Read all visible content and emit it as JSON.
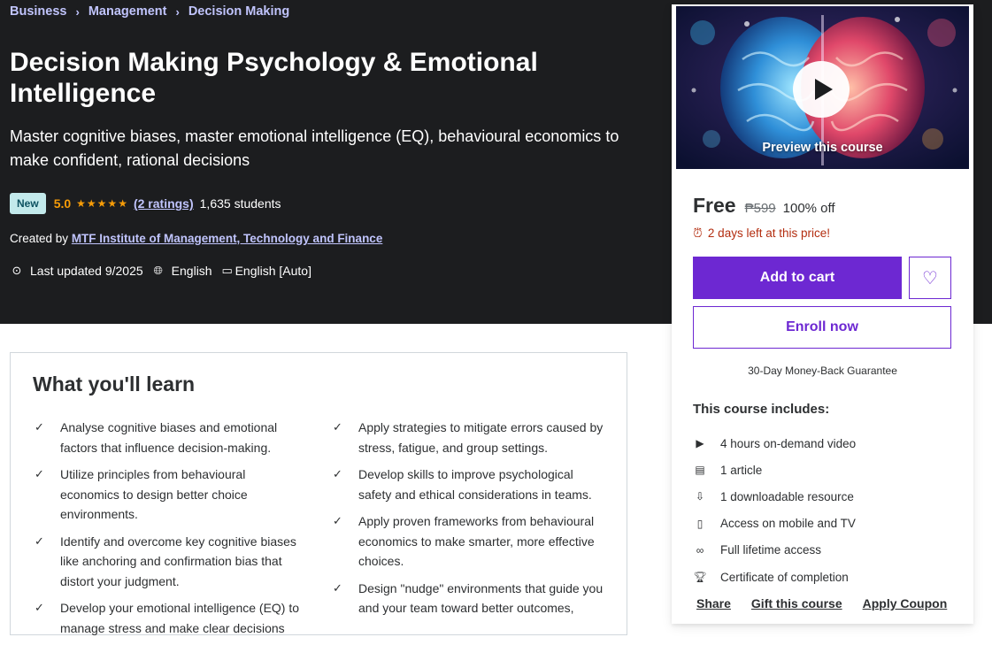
{
  "breadcrumb": [
    "Business",
    "Management",
    "Decision Making"
  ],
  "breadcrumb_sep": "›",
  "course": {
    "title": "Decision Making Psychology & Emotional Intelligence",
    "subtitle": "Master cognitive biases, master emotional intelligence (EQ), behavioural economics to make confident, rational decisions",
    "badge": "New",
    "rating": "5.0",
    "stars": "★★★★★",
    "ratings_link": "(2 ratings)",
    "students": "1,635 students",
    "created_by_label": "Created by",
    "instructor": "MTF Institute of Management, Technology and Finance",
    "last_updated": "Last updated 9/2025",
    "language": "English",
    "captions": "English [Auto]"
  },
  "learn": {
    "heading": "What you'll learn",
    "left": [
      "Analyse cognitive biases and emotional factors that influence decision-making.",
      "Utilize principles from behavioural economics to design better choice environments.",
      "Identify and overcome key cognitive biases like anchoring and confirmation bias that distort your judgment.",
      "Develop your emotional intelligence (EQ) to manage stress and make clear decisions"
    ],
    "right": [
      "Apply strategies to mitigate errors caused by stress, fatigue, and group settings.",
      "Develop skills to improve psychological safety and ethical considerations in teams.",
      "Apply proven frameworks from behavioural economics to make smarter, more effective choices.",
      "Design \"nudge\" environments that guide you and your team toward better outcomes,"
    ]
  },
  "sidebar": {
    "preview_label": "Preview this course",
    "price_now": "Free",
    "price_old": "₱599",
    "discount": "100% off",
    "timer": "2 days left at this price!",
    "add_to_cart": "Add to cart",
    "enroll": "Enroll now",
    "guarantee": "30-Day Money-Back Guarantee",
    "includes_title": "This course includes:",
    "includes": [
      {
        "icon": "video-icon",
        "text": "4 hours on-demand video"
      },
      {
        "icon": "article-icon",
        "text": "1 article"
      },
      {
        "icon": "download-icon",
        "text": "1 downloadable resource"
      },
      {
        "icon": "mobile-icon",
        "text": "Access on mobile and TV"
      },
      {
        "icon": "infinity-icon",
        "text": "Full lifetime access"
      },
      {
        "icon": "trophy-icon",
        "text": "Certificate of completion"
      }
    ],
    "actions": [
      "Share",
      "Gift this course",
      "Apply Coupon"
    ]
  },
  "colors": {
    "hero_bg": "#1c1d1f",
    "accent": "#6d28d2",
    "link": "#c0c4fc",
    "rating": "#f69c08",
    "timer": "#b32d0f"
  }
}
